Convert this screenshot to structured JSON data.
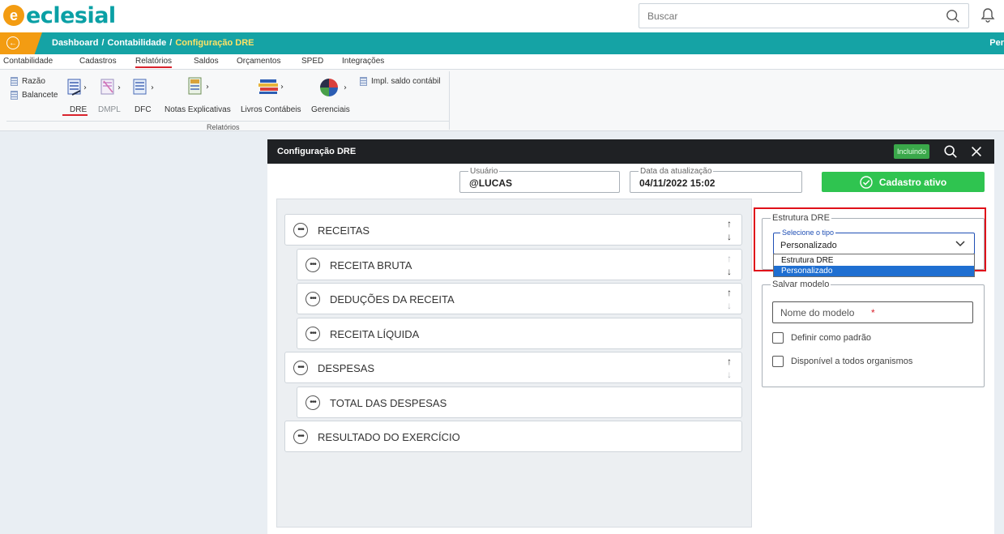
{
  "app": {
    "logo_text": "eclesial"
  },
  "search": {
    "placeholder": "Buscar"
  },
  "breadcrumb": {
    "items": [
      "Dashboard",
      "Contabilidade"
    ],
    "current": "Configuração DRE",
    "right_text": "Per"
  },
  "menu": {
    "tabs": [
      "Contabilidade",
      "Cadastros",
      "Relatórios",
      "Saldos",
      "Orçamentos",
      "SPED",
      "Integrações"
    ],
    "active": "Relatórios"
  },
  "ribbon": {
    "razao": "Razão",
    "balancete": "Balancete",
    "dre": "DRE",
    "dmpl": "DMPL",
    "dfc": "DFC",
    "notas": "Notas Explicativas",
    "livros": "Livros Contábeis",
    "gerenciais": "Gerenciais",
    "impl": "Impl. saldo contábil",
    "group_label": "Relatórios"
  },
  "modal": {
    "title": "Configuração DRE",
    "status_badge": "Incluindo",
    "usuario_label": "Usuário",
    "usuario_value": "@LUCAS",
    "data_label": "Data da atualização",
    "data_value": "04/11/2022 15:02",
    "active_button": "Cadastro ativo"
  },
  "structure": {
    "rows": [
      {
        "label": "RECEITAS",
        "up": "enabled",
        "down": "enabled"
      },
      {
        "label": "RECEITA BRUTA",
        "up": "disabled",
        "down": "enabled"
      },
      {
        "label": "DEDUÇÕES DA RECEITA",
        "up": "enabled",
        "down": "disabled"
      },
      {
        "label": "RECEITA LÍQUIDA"
      },
      {
        "label": "DESPESAS",
        "up": "enabled",
        "down": "disabled"
      },
      {
        "label": "TOTAL DAS DESPESAS"
      },
      {
        "label": "RESULTADO DO EXERCÍCIO"
      }
    ]
  },
  "estrutura": {
    "legend": "Estrutura DRE",
    "select_legend": "Selecione o tipo",
    "selected": "Personalizado",
    "options": [
      "Estrutura DRE",
      "Personalizado"
    ]
  },
  "salvar": {
    "legend": "Salvar modelo",
    "name_placeholder": "Nome do modelo",
    "required_mark": "*",
    "check_default": "Definir como padrão",
    "check_all": "Disponível a todos organismos"
  },
  "colors": {
    "teal": "#15a3a5",
    "orange": "#f39c12",
    "green": "#2fc450",
    "highlight_red": "#e0101a",
    "selection_blue": "#1f6fd1"
  }
}
